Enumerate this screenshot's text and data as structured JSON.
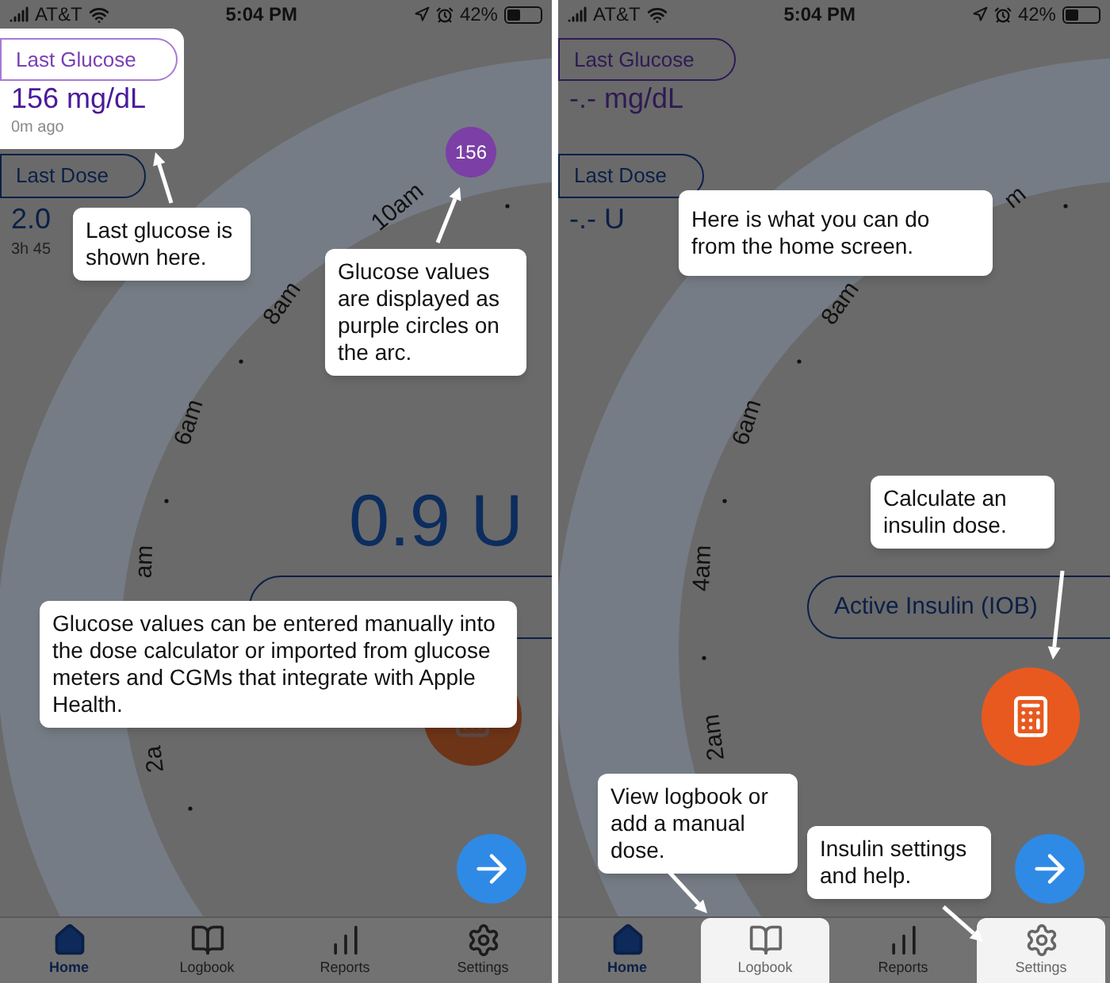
{
  "panels": [
    {
      "status": {
        "carrier": "AT&T",
        "time": "5:04 PM",
        "battery": "42%"
      },
      "last_glucose": {
        "label": "Last Glucose",
        "value": "156 mg/dL",
        "ago": "0m ago",
        "highlighted": true
      },
      "last_dose": {
        "label": "Last Dose",
        "value": "2.0",
        "ago": "3h 45"
      },
      "glucose_points": [
        {
          "value": "156"
        }
      ],
      "arc_labels": [
        "10am",
        "8am",
        "6am",
        "am",
        "2a"
      ],
      "dose": "0.9 U",
      "calculator_highlighted": false,
      "tabs": [
        {
          "label": "Home",
          "selected": true,
          "highlighted": false
        },
        {
          "label": "Logbook",
          "selected": false,
          "highlighted": false
        },
        {
          "label": "Reports",
          "selected": false,
          "highlighted": false
        },
        {
          "label": "Settings",
          "selected": false,
          "highlighted": false
        }
      ],
      "callouts": [
        {
          "kind": "last_glucose",
          "text": "Last glucose is shown here."
        },
        {
          "kind": "glucose_point",
          "text": "Glucose values are displayed as purple circles on the arc."
        },
        {
          "kind": "wide",
          "text": "Glucose values can be entered manually into the dose calculator or imported from glucose meters and CGMs that integrate with Apple Health."
        }
      ]
    },
    {
      "status": {
        "carrier": "AT&T",
        "time": "5:04 PM",
        "battery": "42%"
      },
      "last_glucose": {
        "label": "Last Glucose",
        "value": "-.- mg/dL",
        "highlighted": false
      },
      "last_dose": {
        "label": "Last Dose",
        "value": "-.- U"
      },
      "arc_labels": [
        "m",
        "8am",
        "6am",
        "4am",
        "2am"
      ],
      "active_insulin": "Active Insulin (IOB)",
      "calculator_highlighted": true,
      "tabs": [
        {
          "label": "Home",
          "selected": true,
          "highlighted": false
        },
        {
          "label": "Logbook",
          "selected": false,
          "highlighted": true
        },
        {
          "label": "Reports",
          "selected": false,
          "highlighted": false
        },
        {
          "label": "Settings",
          "selected": false,
          "highlighted": true
        }
      ],
      "callouts": [
        {
          "kind": "intro",
          "text": "Here is what you can do from the home screen."
        },
        {
          "kind": "calculator",
          "text": "Calculate an insulin dose."
        },
        {
          "kind": "logbook",
          "text": "View logbook or add a manual dose."
        },
        {
          "kind": "settings",
          "text": "Insulin settings and help."
        }
      ]
    }
  ]
}
